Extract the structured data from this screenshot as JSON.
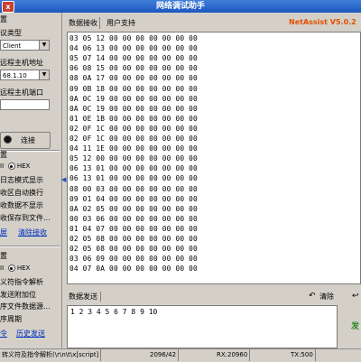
{
  "window": {
    "title": "网络调试助手",
    "close_glyph": "x"
  },
  "settings": {
    "group_title": "置",
    "protocol_label": "议类型",
    "protocol_value": "Client",
    "host_label": "远程主机地址",
    "host_value": "68.1.10",
    "port_label": "远程主机端口",
    "port_value": "",
    "connect_label": "连接"
  },
  "recv_settings": {
    "group_title": "置",
    "radio_ascii": "II",
    "radio_hex": "HEX",
    "options": [
      "日志模式显示",
      "收区自动换行",
      "收数据不显示",
      "收保存到文件..."
    ],
    "link_save": "屏",
    "link_clear": "清除接收"
  },
  "send_settings": {
    "group_title": "置",
    "radio_ascii": "II",
    "radio_hex": "HEX",
    "options": [
      "义符指令解析",
      "发送附加位",
      "序文件数据源...",
      "序周期"
    ],
    "interval_value": "100",
    "interval_unit": "ms",
    "link_shortcut": "令",
    "link_history": "历史发送"
  },
  "recv_tabs": {
    "recv": "数据接收",
    "info": "用户支持"
  },
  "brand": "NetAssist V5.0.2",
  "recv_lines": [
    "03 05 12 00 00 00 00 00 00 00",
    "04 06 13 00 00 00 00 00 00 00",
    "05 07 14 00 00 00 00 00 00 00",
    "06 08 15 00 00 00 00 00 00 00",
    "08 0A 17 00 00 00 00 00 00 00",
    "09 0B 18 00 00 00 00 00 00 00",
    "0A 0C 19 00 00 00 00 00 00 00",
    "0A 0C 19 00 00 00 00 00 00 00",
    "01 0E 1B 00 00 00 00 00 00 00",
    "02 0F 1C 00 00 00 00 00 00 00",
    "02 0F 1C 00 00 00 00 00 00 00",
    "04 11 1E 00 00 00 00 00 00 00",
    "05 12 00 00 00 00 00 00 00 00",
    "06 13 01 00 00 00 00 00 00 00",
    "06 13 01 00 00 00 00 00 00 00",
    "08 00 03 00 00 00 00 00 00 00",
    "09 01 04 00 00 00 00 00 00 00",
    "0A 02 05 00 00 00 00 00 00 00",
    "00 03 06 00 00 00 00 00 00 00",
    "01 04 07 00 00 00 00 00 00 00",
    "02 05 08 00 00 00 00 00 00 00",
    "02 05 08 00 00 00 00 00 00 00",
    "03 06 09 00 00 00 00 00 00 00",
    "04 07 0A 00 00 00 00 00 00 00"
  ],
  "send": {
    "tab_label": "数据发送",
    "clear_label": "清除",
    "input_value": "1 2 3 4 5 6 7 8 9 10",
    "send_button": "发"
  },
  "status": {
    "hint": "转义符及指令解析(\\r\\n\\t\\x[script]",
    "count": "2096/42",
    "rx": "RX:20960",
    "tx": "TX:500"
  },
  "colors": {
    "brand": "#e05000",
    "title_bar": "#1b57c0",
    "link": "#0030c0"
  }
}
